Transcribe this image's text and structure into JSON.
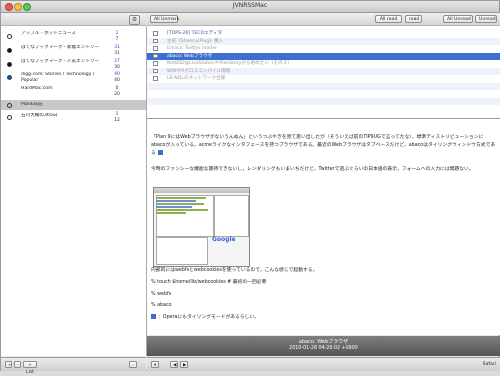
{
  "window": {
    "title": "JVNRSSMac"
  },
  "toolbar": {
    "all_unmark": "All Unmark",
    "all_read": "All read",
    "read": "read",
    "all_unread": "All Unread",
    "unread": "Unread"
  },
  "feeds": [
    {
      "name": "アップル - ホットニュース",
      "unread": "1",
      "total": "7",
      "icon": "feed-circle-icon"
    },
    {
      "name": "はてなブックマーク - 新着エントリー",
      "unread": "31",
      "total": "31",
      "icon": "hatena-icon"
    },
    {
      "name": "はてなブックマーク - 人気エントリー",
      "unread": "27",
      "total": "30",
      "icon": "hatena-icon"
    },
    {
      "name": "digg.com: Stories / Technology / Popular",
      "unread": "40",
      "total": "40",
      "icon": "digg-icon"
    },
    {
      "name": "HardMac.com",
      "unread": "0",
      "total": "20",
      "icon": "none"
    },
    {
      "name": "Plank日記",
      "unread": "",
      "total": "",
      "icon": "feed-circle-icon",
      "selected": true
    },
    {
      "name": "石川大輔の365日",
      "unread": "1",
      "total": "12",
      "icon": "feed-circle-icon"
    }
  ],
  "entries": [
    {
      "title": "[TOPS-20] TECOエディタ",
      "read": false
    },
    {
      "title": "主史《SheerusPlug》購入",
      "read": true
    },
    {
      "title": "Emacs: Twitter reader",
      "read": true
    },
    {
      "title": "abaco: Webブラウザ",
      "read": false,
      "selected": true
    },
    {
      "title": "NetBSD@LiveStationやPlanStoryから始めたい（その３）",
      "read": true
    },
    {
      "title": "W/NやRクロスコンパイル環境",
      "read": true
    },
    {
      "title": "LB-NQLのネットワーク仕様",
      "read": true
    }
  ],
  "article": {
    "para1": "「Plan 9にはWebブラウザがないうんぬん」というつぶやきを見て思い出したが（そういえば前のTIP9UGで言ってたな），標準ディストリビューションにabacoが入っている。acmeライクなインタフェースを持つブラウザである。最近のWebブラウザはタブベースだけど，abacoはタイリングウィンドウ方式である",
    "para2": "今時のファンシーな機能な期待できないし，レンダリングもいまいちだけど，Twitterで遊ぶぐらいの日本語の表示，フォームへの入力には問題ない。",
    "para3": "内部的にはwebfsとwebcookiesを使っているので，こんな感じで起動する。",
    "cmd1": "% touch $home/lib/webcookies # 最初の一回必要",
    "cmd2": "% webfs",
    "cmd3": "% abaco",
    "para4": "：Operaにもタイリングモードがあるらしい。",
    "screenshot_logo": "Google"
  },
  "status": {
    "title": "abaco: Webブラウザ",
    "date": "2010-01-28 04:26:02 +0900",
    "safari": "Safari"
  },
  "bottom": {
    "plus": "+",
    "minus": "-",
    "plus_list": "+ List",
    "minus_right": "-",
    "prev": "◀",
    "next": "▶",
    "more": "▾"
  }
}
